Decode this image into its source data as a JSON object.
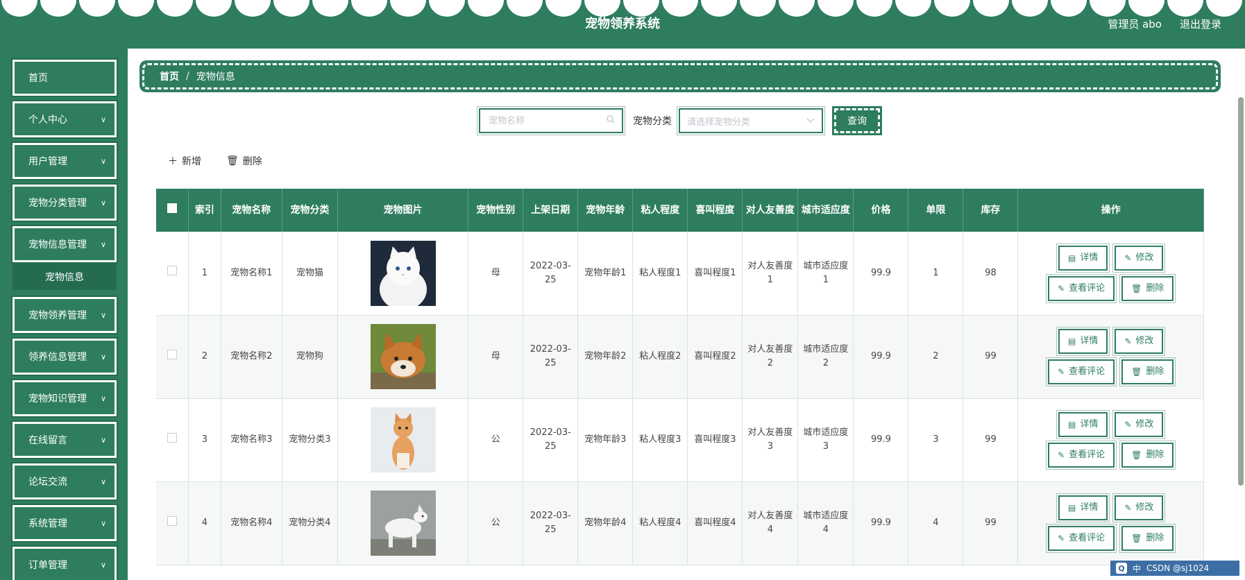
{
  "header": {
    "title": "宠物领养系统",
    "user": "管理员 abo",
    "logout": "退出登录"
  },
  "sidebar": {
    "items": [
      {
        "label": "首页",
        "chevron": false
      },
      {
        "label": "个人中心",
        "chevron": true
      },
      {
        "label": "用户管理",
        "chevron": true
      },
      {
        "label": "宠物分类管理",
        "chevron": true
      },
      {
        "label": "宠物信息管理",
        "chevron": true
      },
      {
        "label": "宠物领养管理",
        "chevron": true
      },
      {
        "label": "领养信息管理",
        "chevron": true
      },
      {
        "label": "宠物知识管理",
        "chevron": true
      },
      {
        "label": "在线留言",
        "chevron": true
      },
      {
        "label": "论坛交流",
        "chevron": true
      },
      {
        "label": "系统管理",
        "chevron": true
      },
      {
        "label": "订单管理",
        "chevron": true
      }
    ],
    "submenu": "宠物信息"
  },
  "breadcrumb": {
    "home": "首页",
    "sep": "/",
    "current": "宠物信息"
  },
  "search": {
    "name_placeholder": "宠物名称",
    "category_label": "宠物分类",
    "category_placeholder": "请选择宠物分类",
    "query": "查询"
  },
  "toolbar": {
    "add": "新增",
    "delete": "删除"
  },
  "table": {
    "headers": [
      "索引",
      "宠物名称",
      "宠物分类",
      "宠物图片",
      "宠物性别",
      "上架日期",
      "宠物年龄",
      "粘人程度",
      "喜叫程度",
      "对人友善度",
      "城市适应度",
      "价格",
      "单限",
      "库存",
      "操作"
    ],
    "rows": [
      {
        "index": "1",
        "name": "宠物名称1",
        "category": "宠物猫",
        "gender": "母",
        "date": "2022-03-25",
        "age": "宠物年龄1",
        "clingy": "粘人程度1",
        "bark": "喜叫程度1",
        "friendly": "对人友善度1",
        "city": "城市适应度1",
        "price": "99.9",
        "limit": "1",
        "stock": "98",
        "img": "white-cat"
      },
      {
        "index": "2",
        "name": "宠物名称2",
        "category": "宠物狗",
        "gender": "母",
        "date": "2022-03-25",
        "age": "宠物年龄2",
        "clingy": "粘人程度2",
        "bark": "喜叫程度2",
        "friendly": "对人友善度2",
        "city": "城市适应度2",
        "price": "99.9",
        "limit": "2",
        "stock": "99",
        "img": "shiba-dog"
      },
      {
        "index": "3",
        "name": "宠物名称3",
        "category": "宠物分类3",
        "gender": "公",
        "date": "2022-03-25",
        "age": "宠物年龄3",
        "clingy": "粘人程度3",
        "bark": "喜叫程度3",
        "friendly": "对人友善度3",
        "city": "城市适应度3",
        "price": "99.9",
        "limit": "3",
        "stock": "99",
        "img": "orange-cat"
      },
      {
        "index": "4",
        "name": "宠物名称4",
        "category": "宠物分类4",
        "gender": "公",
        "date": "2022-03-25",
        "age": "宠物年龄4",
        "clingy": "粘人程度4",
        "bark": "喜叫程度4",
        "friendly": "对人友善度4",
        "city": "城市适应度4",
        "price": "99.9",
        "limit": "4",
        "stock": "99",
        "img": "white-dog"
      }
    ],
    "ops": {
      "detail": "详情",
      "edit": "修改",
      "comments": "查看评论",
      "delete": "删除"
    }
  },
  "taskbar": {
    "ime": "中",
    "watermark": "CSDN @sj1024"
  }
}
